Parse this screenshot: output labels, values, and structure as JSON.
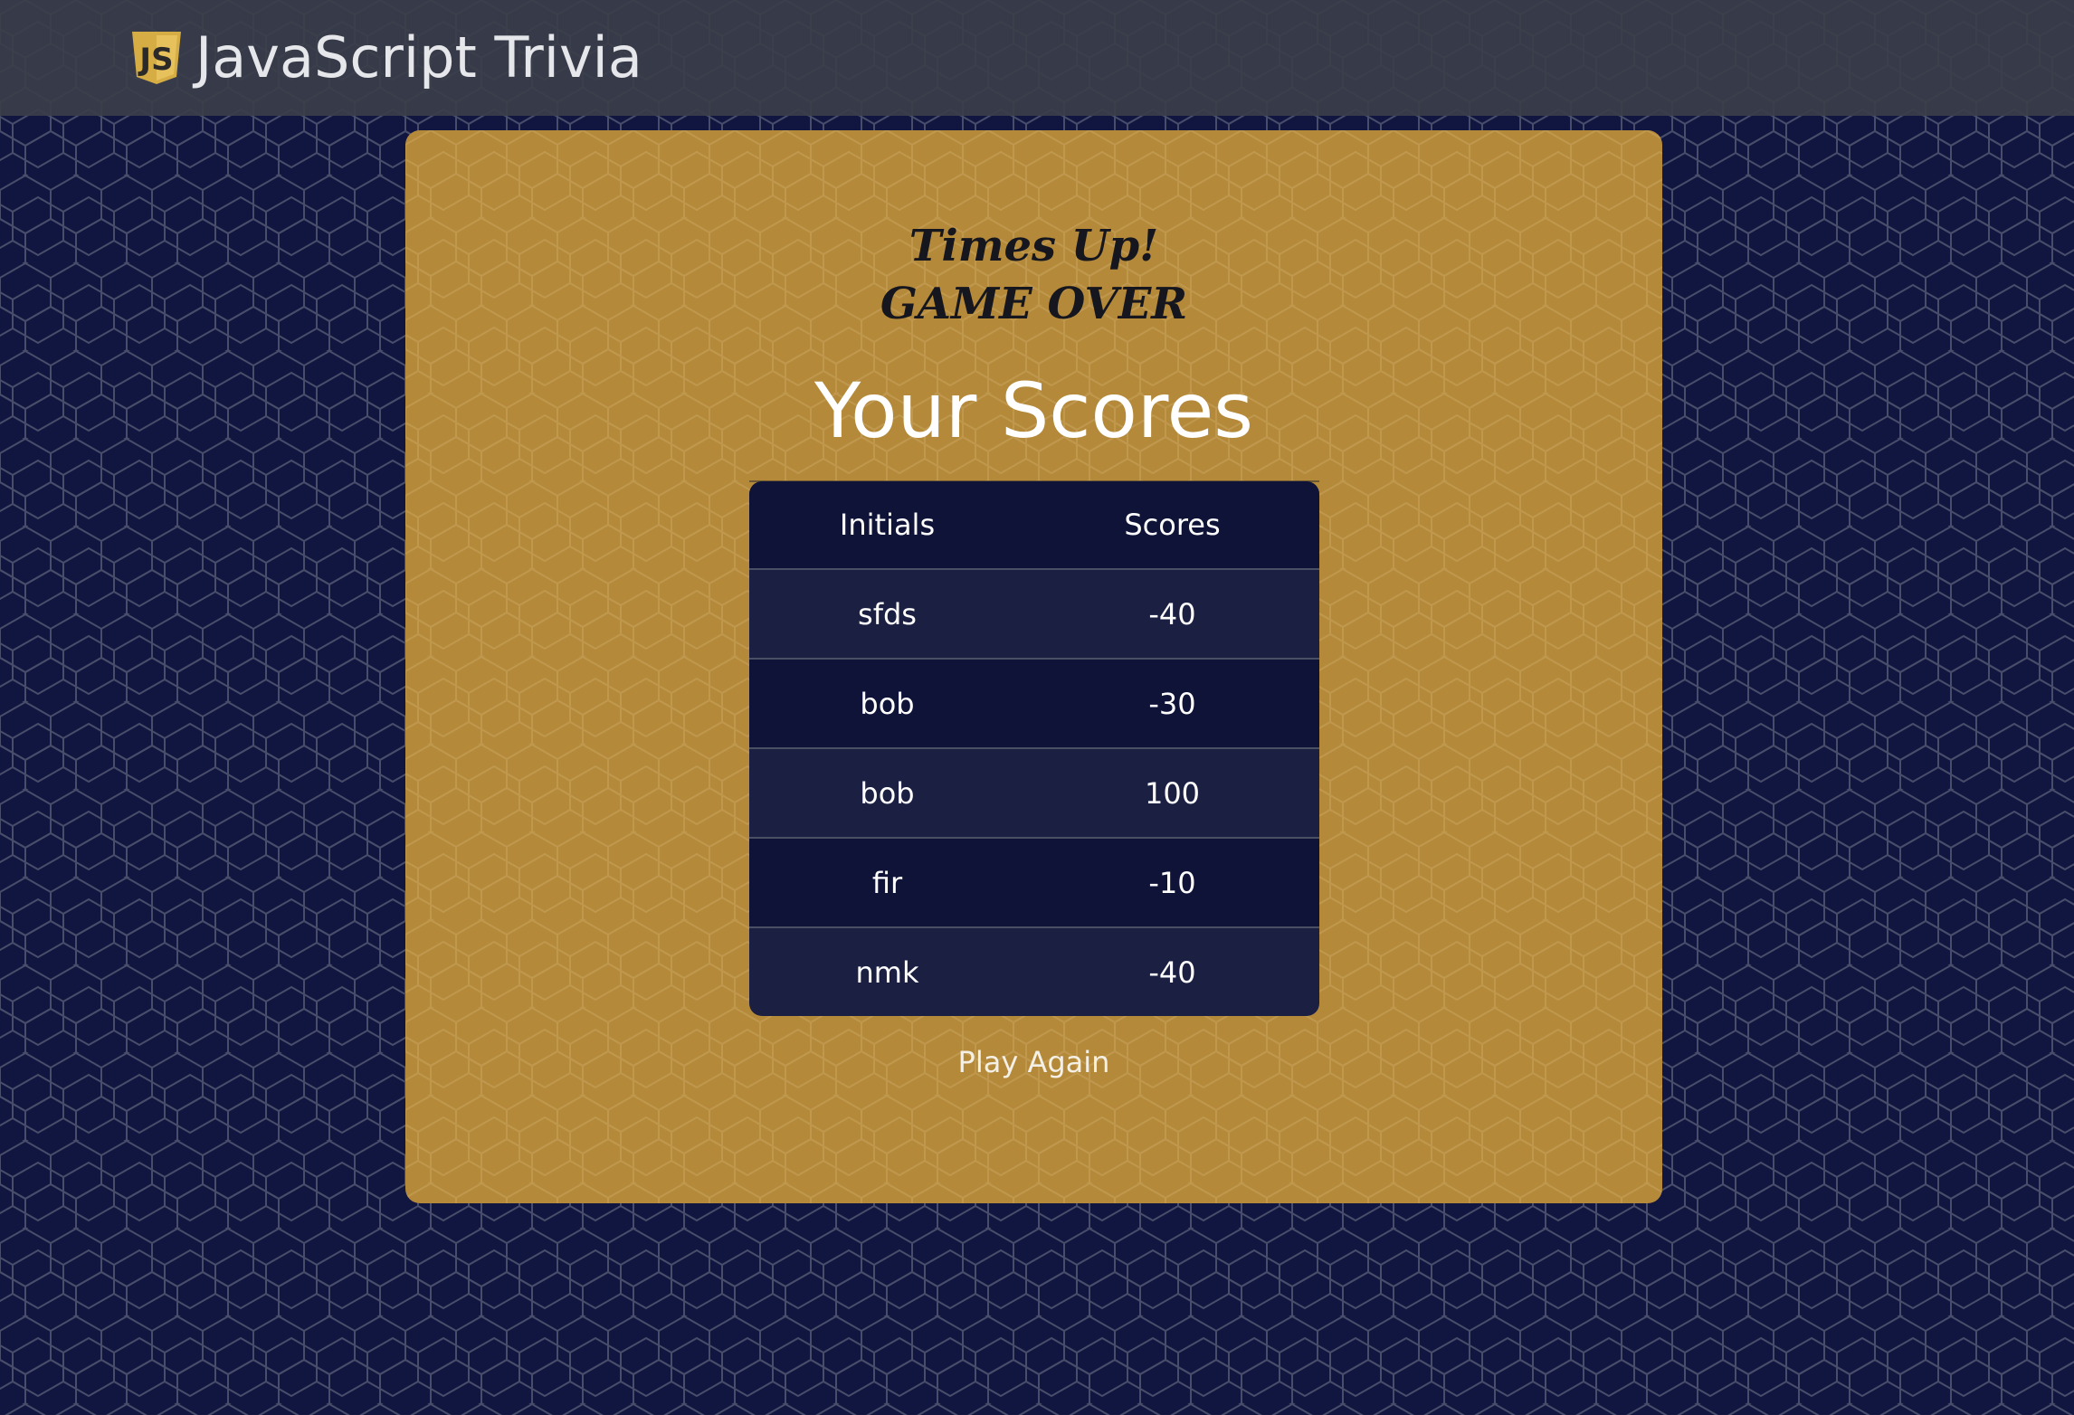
{
  "header": {
    "logo_icon": "js-shield-icon",
    "logo_text": "JS",
    "title": "JavaScript Trivia"
  },
  "game_over": {
    "line1": "Times Up!",
    "line2": "GAME OVER"
  },
  "scores": {
    "heading": "Your Scores",
    "columns": [
      "Initials",
      "Scores"
    ],
    "rows": [
      {
        "initials": "sfds",
        "score": "-40"
      },
      {
        "initials": "bob",
        "score": "-30"
      },
      {
        "initials": "bob",
        "score": "100"
      },
      {
        "initials": "fir",
        "score": "-10"
      },
      {
        "initials": "nmk",
        "score": "-40"
      }
    ]
  },
  "actions": {
    "play_again_label": "Play Again"
  },
  "colors": {
    "background": "#111640",
    "header_bar": "#3a3e4a",
    "card": "#b4893a",
    "table_dark": "#0e1337",
    "table_light": "#1b1f42",
    "logo_gold": "#d9b24a"
  }
}
